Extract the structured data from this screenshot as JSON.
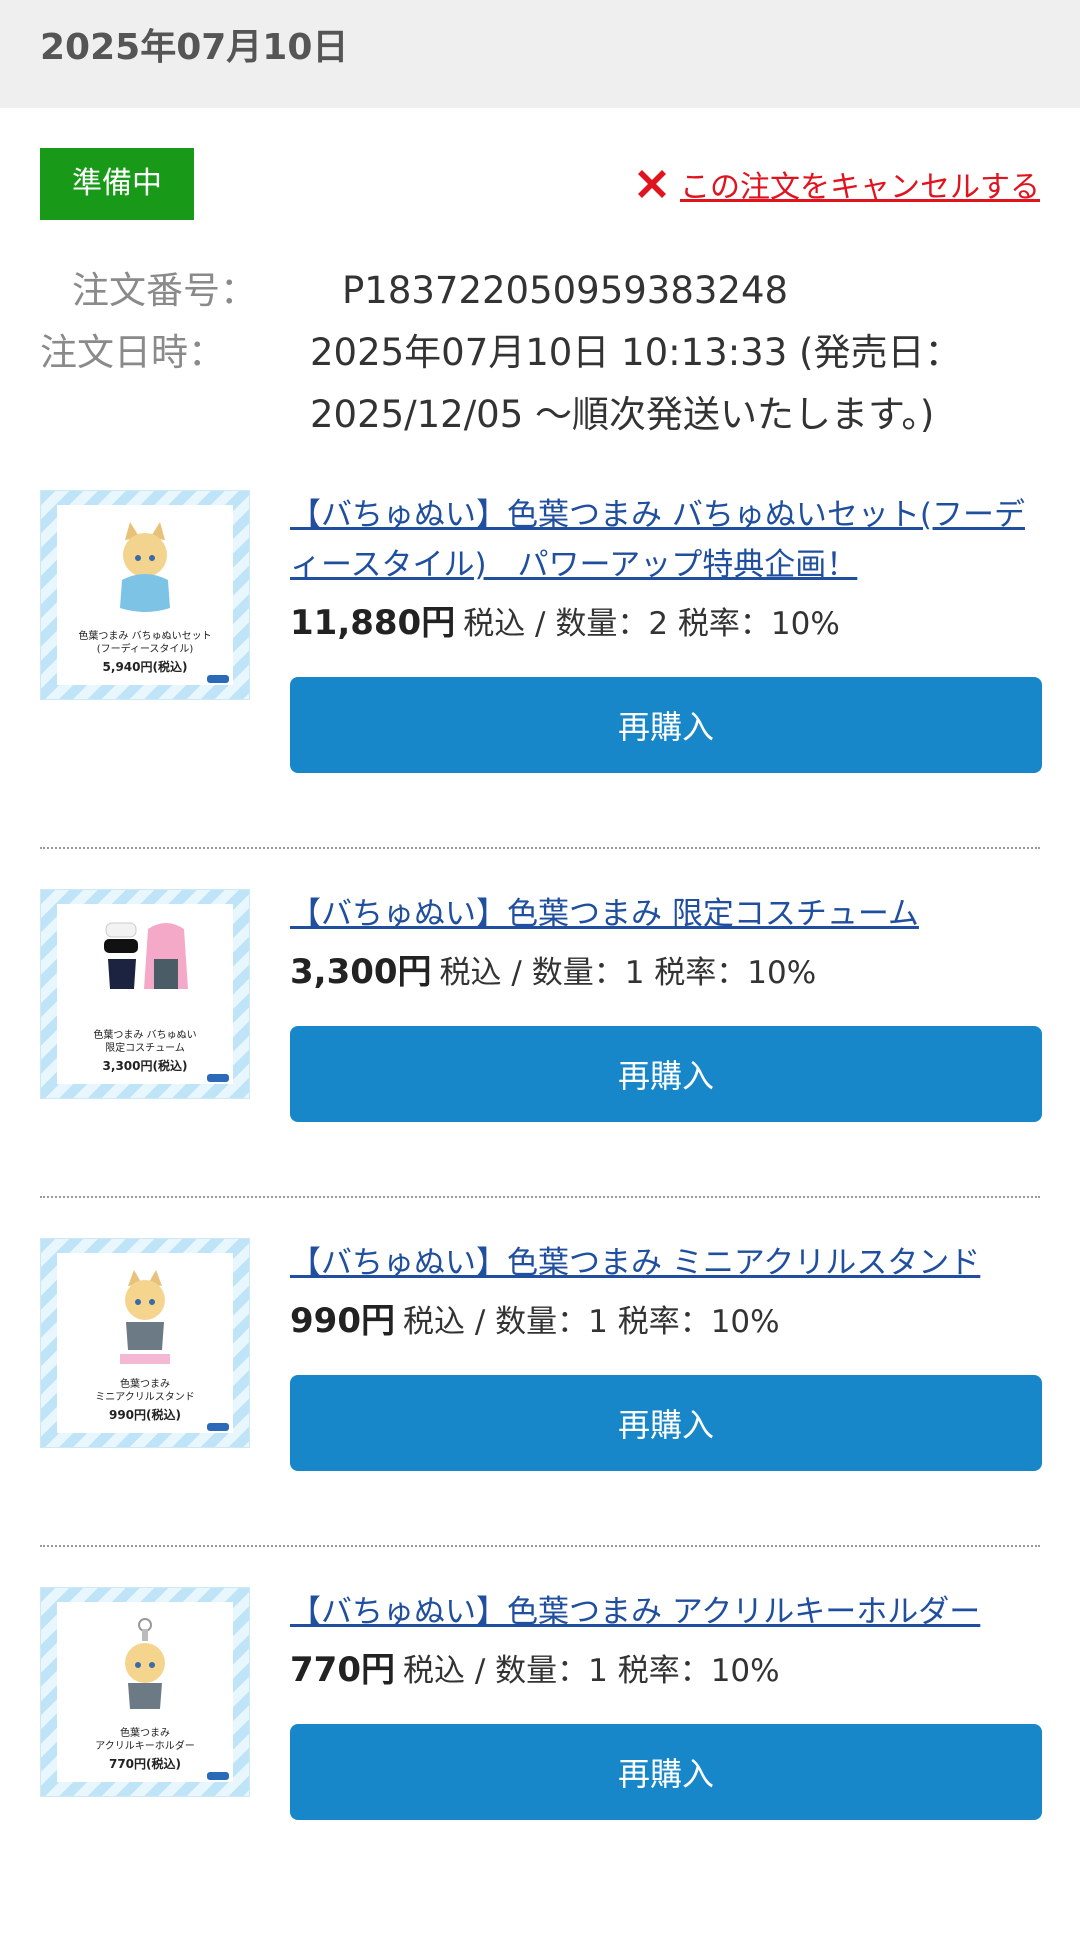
{
  "header": {
    "date": "2025年07月10日"
  },
  "order": {
    "status": "準備中",
    "cancel_label": "この注文をキャンセルする",
    "number_label": "注文番号：",
    "number": "P183722050959383248",
    "datetime_label": "注文日時：",
    "datetime_line1": "2025年07月10日 10:13:33 (発売日：",
    "datetime_line2": "2025/12/05 〜順次発送いたします。)"
  },
  "items": [
    {
      "title": "【バちゅぬい】色葉つまみ バちゅぬいセット(フーディースタイル)　パワーアップ特典企画！",
      "price": "11,880円",
      "detail": "税込 / 数量：2 税率：10%",
      "rebuy_label": "再購入",
      "thumb_caption": "色葉つまみ バちゅぬいセット\n(フーディースタイル)",
      "thumb_price": "5,940円(税込)"
    },
    {
      "title": "【バちゅぬい】色葉つまみ 限定コスチューム",
      "price": "3,300円",
      "detail": "税込 / 数量：1 税率：10%",
      "rebuy_label": "再購入",
      "thumb_caption": "色葉つまみ バちゅぬい\n限定コスチューム",
      "thumb_price": "3,300円(税込)"
    },
    {
      "title": "【バちゅぬい】色葉つまみ ミニアクリルスタンド",
      "price": "990円",
      "detail": "税込 / 数量：1 税率：10%",
      "rebuy_label": "再購入",
      "thumb_caption": "色葉つまみ\nミニアクリルスタンド",
      "thumb_price": "990円(税込)"
    },
    {
      "title": "【バちゅぬい】色葉つまみ アクリルキーホルダー",
      "price": "770円",
      "detail": "税込 / 数量：1 税率：10%",
      "rebuy_label": "再購入",
      "thumb_caption": "色葉つまみ\nアクリルキーホルダー",
      "thumb_price": "770円(税込)"
    }
  ]
}
